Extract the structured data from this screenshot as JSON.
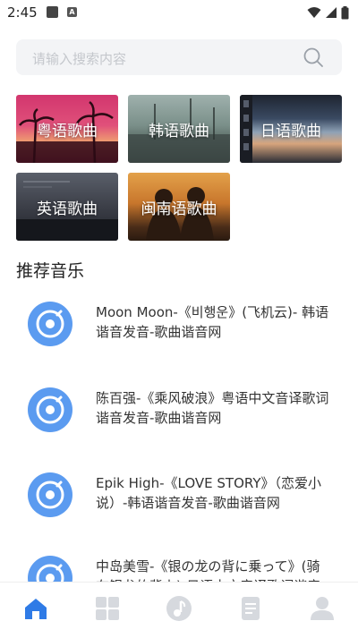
{
  "status_bar": {
    "time": "2:45",
    "icons": [
      "app-notification-icon",
      "app-a-icon",
      "wifi-icon",
      "signal-icon",
      "battery-icon"
    ]
  },
  "search": {
    "placeholder": "请输入搜索内容"
  },
  "categories": [
    {
      "label": "粤语歌曲"
    },
    {
      "label": "韩语歌曲"
    },
    {
      "label": "日语歌曲"
    },
    {
      "label": "英语歌曲"
    },
    {
      "label": "闽南语歌曲"
    }
  ],
  "section": {
    "title": "推荐音乐"
  },
  "songs": [
    {
      "title": "Moon Moon-《비행운》(飞机云)- 韩语谐音发音-歌曲谐音网"
    },
    {
      "title": "陈百强-《乘风破浪》粤语中文音译歌词谐音发音-歌曲谐音网"
    },
    {
      "title": "Epik High-《LOVE STORY》（恋爱小说）-韩语谐音发音-歌曲谐音网"
    },
    {
      "title": "中岛美雪-《银の龙の背に乗って》(骑在银龙的背上)-日语中文音译歌词谐音"
    }
  ],
  "bottom_nav": {
    "items": [
      "home-icon",
      "grid-icon",
      "music-icon",
      "list-icon",
      "user-icon"
    ],
    "active_color": "#2f7be6",
    "inactive_color": "#d6d9de"
  },
  "colors": {
    "disc_outer": "#5b9bf0",
    "disc_inner": "#ffffff"
  }
}
